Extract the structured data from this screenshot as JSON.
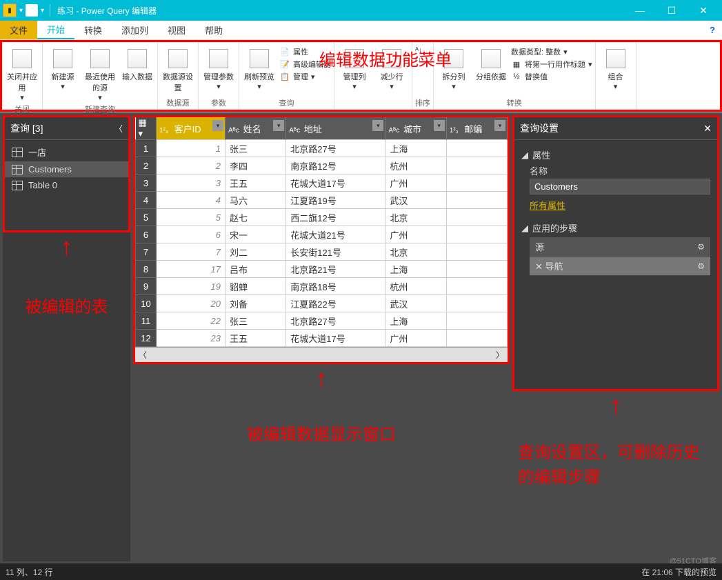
{
  "window": {
    "title": "练习 - Power Query 编辑器"
  },
  "ribbon": {
    "tabs": {
      "file": "文件",
      "home": "开始",
      "transform": "转换",
      "addcol": "添加列",
      "view": "视图",
      "help": "帮助"
    },
    "groups": {
      "close": "关闭",
      "newquery": "新建查询",
      "datasource": "数据源",
      "params": "参数",
      "query": "查询",
      "sort": "排序",
      "transform2": "转换"
    },
    "buttons": {
      "closeapply": "关闭并应用",
      "newsource": "新建源",
      "recent": "最近使用的源",
      "enterdata": "输入数据",
      "dssettings": "数据源设置",
      "manageparam": "管理参数",
      "refresh": "刷新预览",
      "props": "属性",
      "adveditor": "高级编辑器",
      "manage": "管理",
      "managecols": "管理列",
      "reducerows": "减少行",
      "splitcol": "拆分列",
      "groupby": "分组依据",
      "datatype": "数据类型: 整数",
      "firstrow": "将第一行用作标题",
      "replace": "替换值",
      "combine": "组合"
    }
  },
  "annotations": {
    "menu": "编辑数据功能菜单",
    "left": "被编辑的表",
    "mid": "被编辑数据显示窗口",
    "right": "查询设置区，可删除历史的编辑步骤"
  },
  "queries": {
    "header": "查询 [3]",
    "items": [
      "一店",
      "Customers",
      "Table 0"
    ],
    "active": 1
  },
  "grid": {
    "columns": [
      "客户ID",
      "姓名",
      "地址",
      "城市",
      "邮编"
    ],
    "rows": [
      {
        "n": 1,
        "id": 1,
        "name": "张三",
        "addr": "北京路27号",
        "city": "上海"
      },
      {
        "n": 2,
        "id": 2,
        "name": "李四",
        "addr": "南京路12号",
        "city": "杭州"
      },
      {
        "n": 3,
        "id": 3,
        "name": "王五",
        "addr": "花城大道17号",
        "city": "广州"
      },
      {
        "n": 4,
        "id": 4,
        "name": "马六",
        "addr": "江夏路19号",
        "city": "武汉"
      },
      {
        "n": 5,
        "id": 5,
        "name": "赵七",
        "addr": "西二旗12号",
        "city": "北京"
      },
      {
        "n": 6,
        "id": 6,
        "name": "宋一",
        "addr": "花城大道21号",
        "city": "广州"
      },
      {
        "n": 7,
        "id": 7,
        "name": "刘二",
        "addr": "长安街121号",
        "city": "北京"
      },
      {
        "n": 8,
        "id": 17,
        "name": "吕布",
        "addr": "北京路21号",
        "city": "上海"
      },
      {
        "n": 9,
        "id": 19,
        "name": "貂蝉",
        "addr": "南京路18号",
        "city": "杭州"
      },
      {
        "n": 10,
        "id": 20,
        "name": "刘备",
        "addr": "江夏路22号",
        "city": "武汉"
      },
      {
        "n": 11,
        "id": 22,
        "name": "张三",
        "addr": "北京路27号",
        "city": "上海"
      },
      {
        "n": 12,
        "id": 23,
        "name": "王五",
        "addr": "花城大道17号",
        "city": "广州"
      }
    ]
  },
  "settings": {
    "header": "查询设置",
    "propsLabel": "属性",
    "nameLabel": "名称",
    "nameValue": "Customers",
    "allProps": "所有属性",
    "stepsLabel": "应用的步骤",
    "steps": [
      "源",
      "导航"
    ],
    "activeStep": 1
  },
  "status": {
    "left": "11 列、12 行",
    "right": "在 21:06 下载的预览"
  },
  "watermark": "@51CTO博客"
}
